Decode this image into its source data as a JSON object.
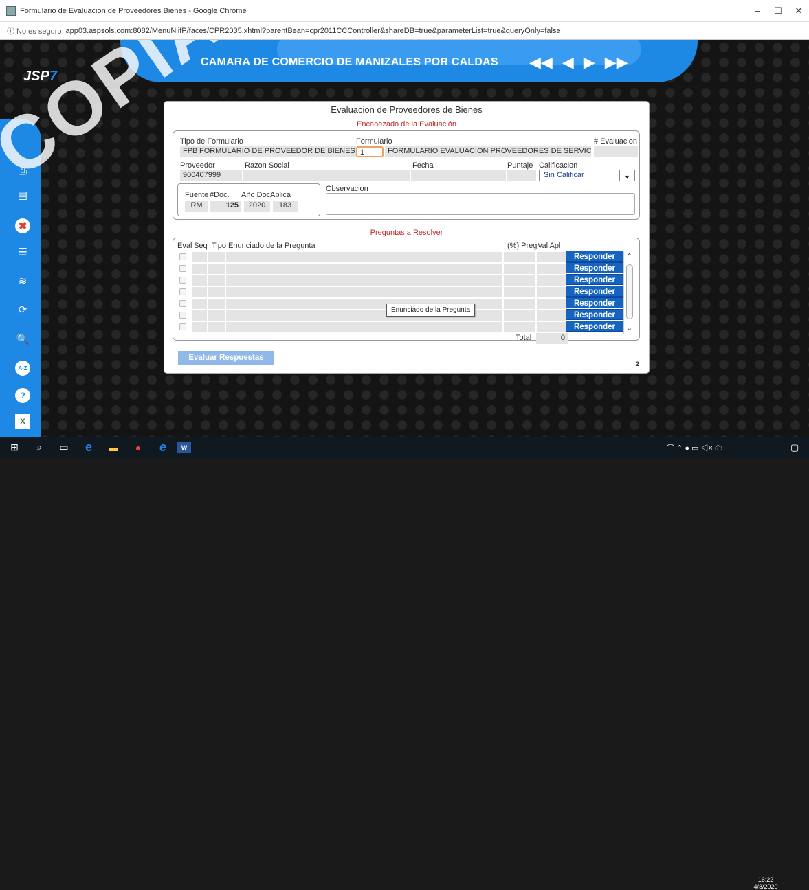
{
  "window": {
    "title": "Formulario de Evaluacion de Proveedores Bienes - Google Chrome",
    "minimize": "–",
    "maximize": "☐",
    "close": "✕"
  },
  "address": {
    "security": "ⓘ No es seguro",
    "url": "app03.aspsols.com:8082/MenuNiifP/faces/CPR2035.xhtml?parentBean=cpr2011CCController&shareDB=true&parameterList=true&queryOnly=false"
  },
  "banner": {
    "company": "CAMARA DE COMERCIO DE MANIZALES POR CALDAS"
  },
  "logo": {
    "text": "SP",
    "seven": "7",
    "prefix": "J"
  },
  "watermark": "COPIA",
  "form": {
    "title": "Evaluacion de Proveedores de Bienes",
    "header_section": "Encabezado de la Evaluación",
    "lbl_tipo": "Tipo de Formulario",
    "tipo_code": "FPB",
    "tipo_name": "FORMULARIO DE PROVEEDOR DE BIENES",
    "lbl_formulario": "Formulario",
    "formulario_value": "1",
    "formulario_name": "FORMULARIO EVALUACION PROVEEDORES DE SERVICIOS",
    "lbl_evaluacion": "# Evaluacion",
    "evaluacion_value": "",
    "lbl_proveedor": "Proveedor",
    "proveedor_value": "900407999",
    "lbl_razon": "Razon Social",
    "razon_value": "",
    "lbl_fecha": "Fecha",
    "fecha_value": "",
    "lbl_puntaje": "Puntaje",
    "puntaje_value": "",
    "lbl_calificacion": "Calificacion",
    "calificacion_value": "Sin Calificar",
    "lbl_fuente": "Fuente",
    "lbl_doc": "#Doc.",
    "lbl_anio": "Año Doc.",
    "lbl_aplica": "Aplica",
    "fuente_value": "RM",
    "doc_value": "125",
    "anio_value": "2020",
    "aplica_value": "183",
    "lbl_observacion": "Observacion",
    "questions_section": "Preguntas a Resolver",
    "col_eval": "Eval",
    "col_seq": "Seq",
    "col_tipo": "Tipo",
    "col_enunciado": "Enunciado de la Pregunta",
    "col_preg": "(%) Preg",
    "col_val": "Val Apl",
    "responder": [
      "Responder",
      "Responder",
      "Responder",
      "Responder",
      "Responder",
      "Responder",
      "Responder"
    ],
    "tooltip": "Enunciado de la Pregunta",
    "lbl_total": "Total",
    "total_value": "0",
    "eval_button": "Evaluar Respuestas",
    "page_count": "2"
  },
  "taskbar": {
    "time": "16:22",
    "date": "4/3/2020"
  }
}
